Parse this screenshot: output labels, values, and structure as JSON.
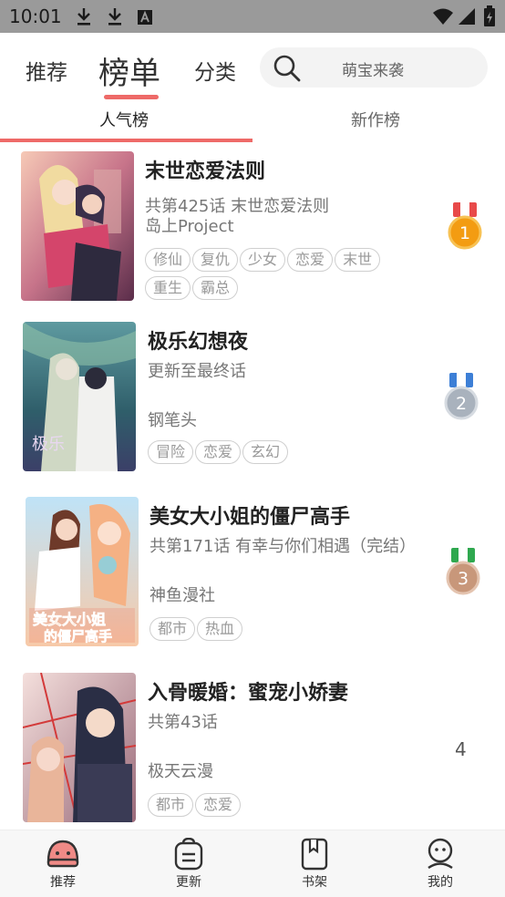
{
  "status_bar": {
    "time": "10:01",
    "left_icons": [
      "download-icon",
      "download-icon",
      "font-icon"
    ],
    "right_icons": [
      "wifi-icon",
      "signal-icon",
      "battery-icon"
    ]
  },
  "header": {
    "tabs": [
      {
        "label": "推荐",
        "active": false
      },
      {
        "label": "榜单",
        "active": true
      },
      {
        "label": "分类",
        "active": false
      }
    ],
    "search_placeholder": "萌宝来袭",
    "accent_color": "#ee6a68"
  },
  "sub_tabs": [
    {
      "label": "人气榜",
      "active": true
    },
    {
      "label": "新作榜",
      "active": false
    }
  ],
  "items": [
    {
      "rank": "1",
      "rank_color": "#f39c12",
      "title": "末世恋爱法则",
      "desc": "共第425话 末世恋爱法则",
      "author": "岛上Project",
      "tags": [
        "修仙",
        "复仇",
        "少女",
        "恋爱",
        "末世",
        "重生",
        "霸总"
      ]
    },
    {
      "rank": "2",
      "rank_color": "#a9b2bd",
      "title": "极乐幻想夜",
      "desc": "更新至最终话",
      "author": "钢笔头",
      "tags": [
        "冒险",
        "恋爱",
        "玄幻"
      ]
    },
    {
      "rank": "3",
      "rank_color": "#c8977a",
      "title": "美女大小姐的僵尸高手",
      "desc": "共第171话 有幸与你们相遇（完结）",
      "author": "神鱼漫社",
      "tags": [
        "都市",
        "热血"
      ]
    },
    {
      "rank": "4",
      "title": "入骨暖婚：蜜宠小娇妻",
      "desc": "共第43话",
      "author": "极天云漫",
      "tags": [
        "都市",
        "恋爱"
      ]
    }
  ],
  "bottom_nav": [
    {
      "label": "推荐",
      "icon": "home-icon",
      "active": true
    },
    {
      "label": "更新",
      "icon": "update-icon",
      "active": false
    },
    {
      "label": "书架",
      "icon": "bookshelf-icon",
      "active": false
    },
    {
      "label": "我的",
      "icon": "profile-icon",
      "active": false
    }
  ]
}
